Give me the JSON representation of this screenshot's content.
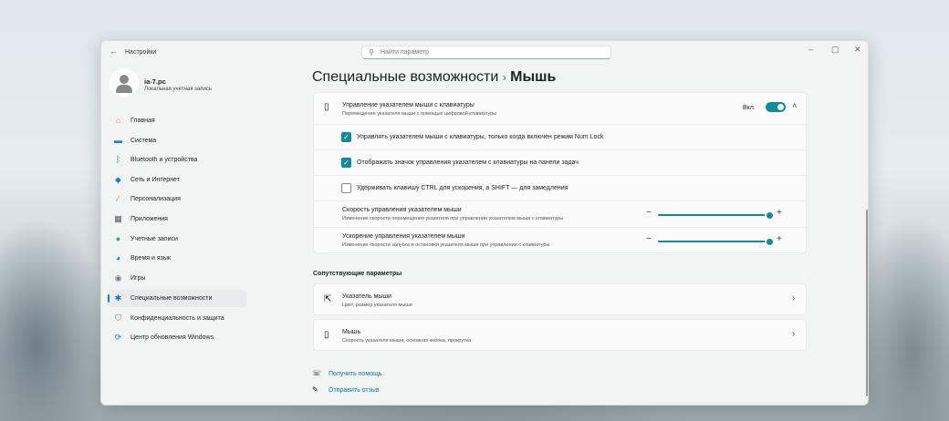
{
  "window": {
    "title": "Настройки",
    "search_placeholder": "Найти параметр",
    "minimize": "–",
    "maximize": "▢",
    "close": "✕"
  },
  "user": {
    "name": "ia-7.pc",
    "account": "Локальная учетная запись"
  },
  "sidebar": {
    "items": [
      {
        "label": "Главная",
        "icon": "home-icon",
        "glyph": "⌂",
        "color": "#e07a3a"
      },
      {
        "label": "Система",
        "icon": "system-icon",
        "glyph": "▬",
        "color": "#1f7fd0"
      },
      {
        "label": "Bluetooth и устройства",
        "icon": "bluetooth-icon",
        "glyph": "ᛒ",
        "color": "#1f7fd0"
      },
      {
        "label": "Сеть и Интернет",
        "icon": "wifi-icon",
        "glyph": "◆",
        "color": "#1f7fd0"
      },
      {
        "label": "Персонализация",
        "icon": "brush-icon",
        "glyph": "⁄",
        "color": "#e07a3a"
      },
      {
        "label": "Приложения",
        "icon": "apps-icon",
        "glyph": "▦",
        "color": "#556"
      },
      {
        "label": "Учетные записи",
        "icon": "accounts-icon",
        "glyph": "●",
        "color": "#2aa58a"
      },
      {
        "label": "Время и язык",
        "icon": "globe-icon",
        "glyph": "◕",
        "color": "#1f7fd0"
      },
      {
        "label": "Игры",
        "icon": "gamepad-icon",
        "glyph": "◉",
        "color": "#778"
      },
      {
        "label": "Специальные возможности",
        "icon": "accessibility-icon",
        "glyph": "✱",
        "color": "#1f6fc0",
        "active": true
      },
      {
        "label": "Конфиденциальность и защита",
        "icon": "shield-icon",
        "glyph": "⛉",
        "color": "#778"
      },
      {
        "label": "Центр обновления Windows",
        "icon": "update-icon",
        "glyph": "⟳",
        "color": "#1f7fd0"
      }
    ]
  },
  "header": {
    "breadcrumb_parent": "Специальные возможности",
    "separator": "›",
    "current": "Мышь"
  },
  "mouse_keys": {
    "title": "Управление указателем мыши с клавиатуры",
    "subtitle": "Перемещение указателя мыши с помощью цифровой клавиатуры",
    "state_label": "Вкл.",
    "enabled": true,
    "options": [
      {
        "label": "Управлять указателем мыши с клавиатуры, только когда включен режим Num Lock",
        "checked": true
      },
      {
        "label": "Отображать значок управления указателем с клавиатуры на панели задач",
        "checked": true
      },
      {
        "label": "Удерживать клавишу CTRL для ускорения, а SHIFT — для замедления",
        "checked": false
      }
    ],
    "sliders": [
      {
        "title": "Скорость управления указателем мыши",
        "subtitle": "Изменение скорости перемещения указателя при управлении указателем мыши с клавиатуры",
        "value_percent": 100
      },
      {
        "title": "Ускорение управления указателем мыши",
        "subtitle": "Изменение скорости запуска и остановки указателя мыши при управлении с клавиатуры",
        "value_percent": 100
      }
    ]
  },
  "related": {
    "heading": "Сопутствующие параметры",
    "items": [
      {
        "title": "Указатель мыши",
        "subtitle": "Цвет, размер указателя мыши",
        "icon": "pointer-icon"
      },
      {
        "title": "Мышь",
        "subtitle": "Скорость указателя мыши, основная кнопка, прокрутка",
        "icon": "mouse-icon"
      }
    ]
  },
  "links": {
    "help": "Получить помощь",
    "feedback": "Отправить отзыв"
  },
  "accent": "#0e8c99"
}
